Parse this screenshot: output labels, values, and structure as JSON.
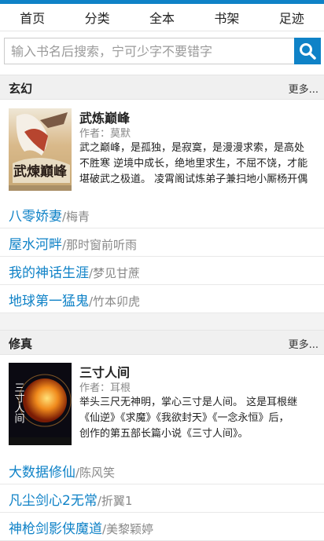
{
  "nav": [
    "首页",
    "分类",
    "全本",
    "书架",
    "足迹"
  ],
  "search": {
    "placeholder": "输入书名后搜索，宁可少字不要错字"
  },
  "sections": [
    {
      "title": "玄幻",
      "more": "更多...",
      "featured": {
        "title": "武炼巅峰",
        "author": "作者：莫默",
        "desc": [
          "武之巅峰，是孤独，是寂寞，是漫漫求索，是高处",
          "不胜寒 逆境中成长，绝地里求生，不屈不饶，才能",
          "堪破武之极道。 凌霄阁试炼弟子兼扫地小厮杨开偶"
        ],
        "cover_text": "武煉巔峰"
      },
      "items": [
        {
          "title": "八零娇妻",
          "author": "/梅青"
        },
        {
          "title": "屋水河畔",
          "author": "/那时窗前听雨"
        },
        {
          "title": "我的神话生涯",
          "author": "/梦见甘蔗"
        },
        {
          "title": "地球第一猛鬼",
          "author": "/竹本卯虎"
        }
      ]
    },
    {
      "title": "修真",
      "more": "更多...",
      "featured": {
        "title": "三寸人间",
        "author": "作者：耳根",
        "desc": [
          "举头三尺无神明，掌心三寸是人间。 这是耳根继",
          "《仙逆》《求魔》《我欲封天》《一念永恒》后，",
          "创作的第五部长篇小说《三寸人间》。"
        ],
        "cover_text": "三寸人间"
      },
      "items": [
        {
          "title": "大数据修仙",
          "author": "/陈风笑"
        },
        {
          "title": "凡尘剑心2无常",
          "author": "/折翼1"
        },
        {
          "title": "神枪剑影侠魔道",
          "author": "/美黎颖婷"
        }
      ]
    }
  ],
  "colors": {
    "accent": "#0f82c7",
    "link": "#0f82c7"
  }
}
